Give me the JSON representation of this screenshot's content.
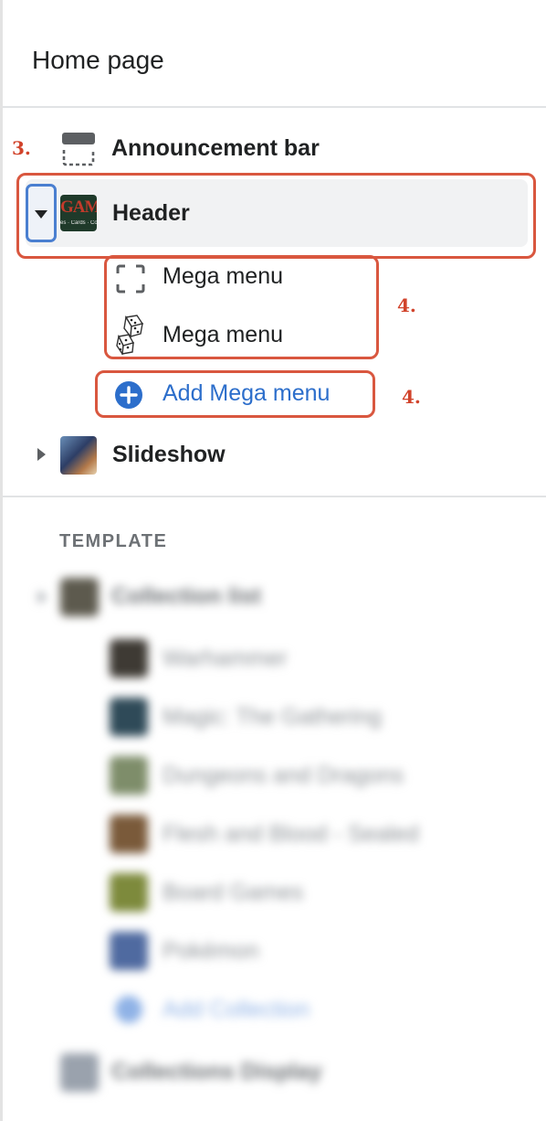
{
  "page_title": "Home page",
  "annotations": {
    "step3": "3.",
    "step4a": "4.",
    "step4b": "4."
  },
  "sections": {
    "announcement_bar": {
      "label": "Announcement bar",
      "icon": "announcement-bar-icon"
    },
    "header": {
      "label": "Header",
      "toggle": "expanded",
      "thumb_text": "GAM",
      "thumb_subtext": "es · Cards · Co",
      "children": [
        {
          "label": "Mega menu",
          "icon": "dashed-square-icon"
        },
        {
          "label": "Mega menu",
          "icon": "dice-icon"
        }
      ],
      "add_label": "Add Mega menu"
    },
    "slideshow": {
      "label": "Slideshow",
      "toggle": "collapsed"
    }
  },
  "template": {
    "heading": "TEMPLATE",
    "collection_list": {
      "label": "Collection list",
      "items": [
        {
          "label": "Warhammer"
        },
        {
          "label": "Magic: The Gathering"
        },
        {
          "label": "Dungeons and Dragons"
        },
        {
          "label": "Flesh and Blood - Sealed"
        },
        {
          "label": "Board Games"
        },
        {
          "label": "Pokémon"
        }
      ],
      "add_label": "Add Collection"
    },
    "collections_display": {
      "label": "Collections Display"
    }
  },
  "colors": {
    "accent_blue": "#2c6ecb",
    "annotation_red": "#d9573f",
    "text": "#202223",
    "muted": "#6d7175"
  }
}
